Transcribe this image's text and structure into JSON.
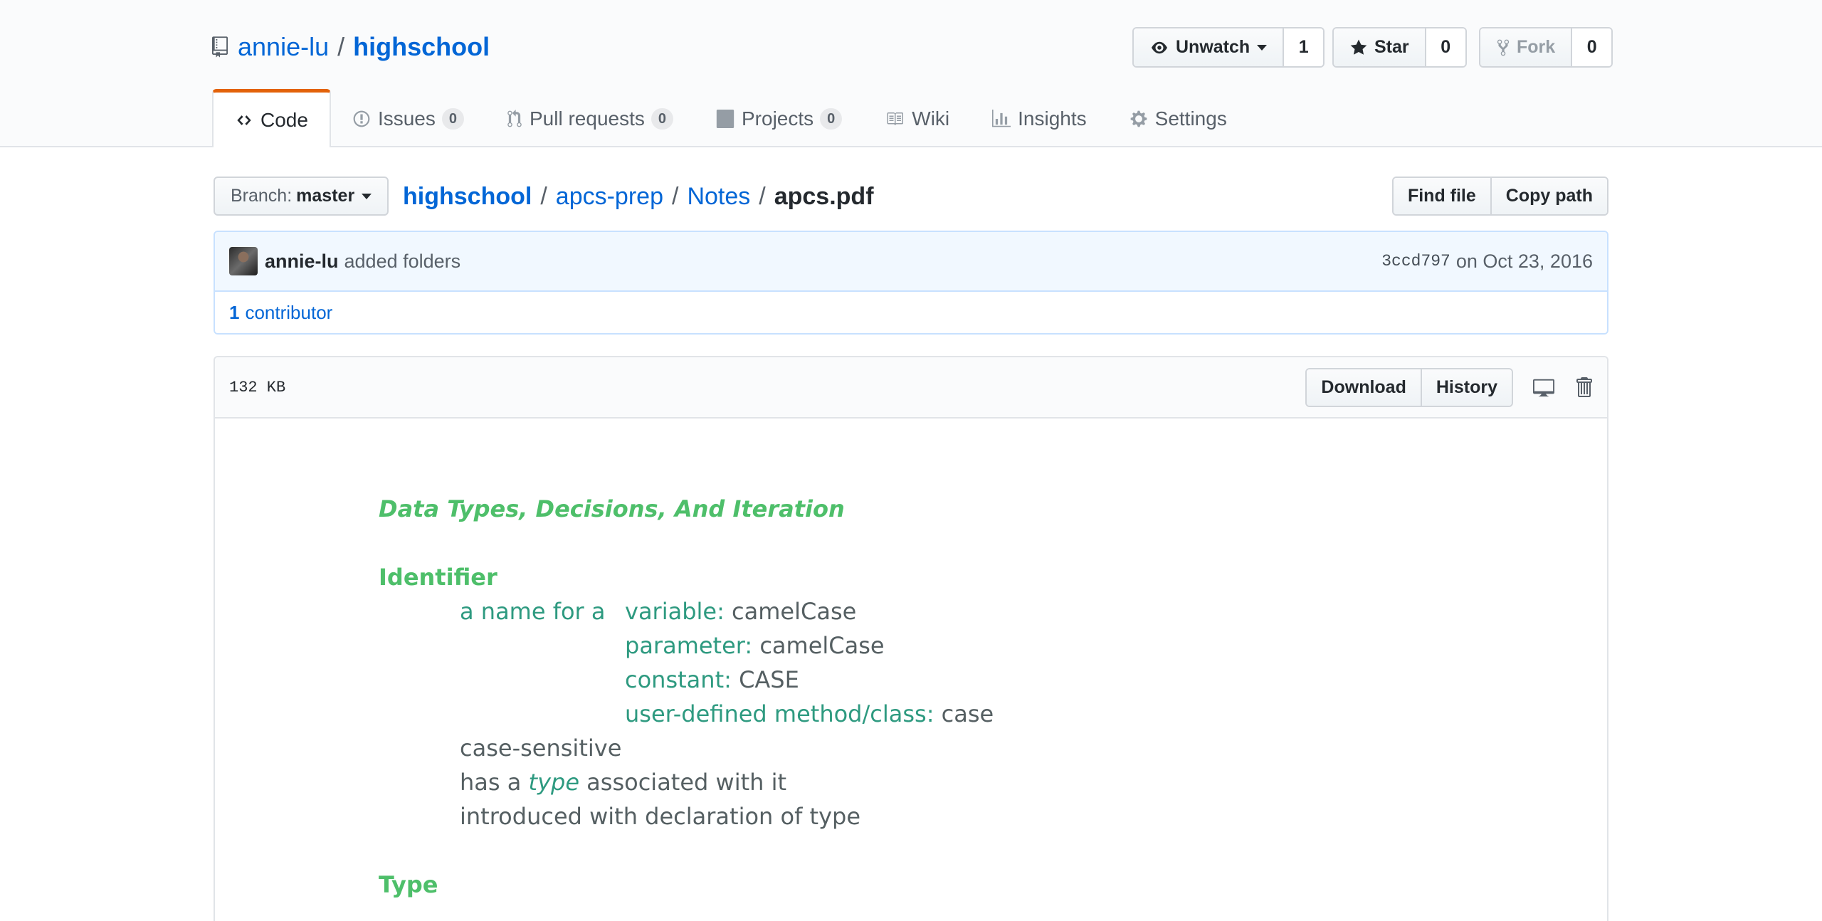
{
  "repo": {
    "owner": "annie-lu",
    "separator": "/",
    "name": "highschool"
  },
  "actions": {
    "watch": {
      "label": "Unwatch",
      "count": "1"
    },
    "star": {
      "label": "Star",
      "count": "0"
    },
    "fork": {
      "label": "Fork",
      "count": "0"
    }
  },
  "tabs": [
    {
      "label": "Code",
      "icon": "code-icon",
      "selected": true
    },
    {
      "label": "Issues",
      "count": "0",
      "icon": "issue-icon"
    },
    {
      "label": "Pull requests",
      "count": "0",
      "icon": "pull-request-icon"
    },
    {
      "label": "Projects",
      "count": "0",
      "icon": "project-icon"
    },
    {
      "label": "Wiki",
      "icon": "book-icon"
    },
    {
      "label": "Insights",
      "icon": "graph-icon"
    },
    {
      "label": "Settings",
      "icon": "gear-icon"
    }
  ],
  "branch": {
    "prefix": "Branch:",
    "name": "master"
  },
  "breadcrumb": {
    "root": "highschool",
    "sep": "/",
    "parts": [
      "apcs-prep",
      "Notes"
    ],
    "file": "apcs.pdf"
  },
  "file_nav_buttons": {
    "find_file": "Find file",
    "copy_path": "Copy path"
  },
  "commit": {
    "author": "annie-lu",
    "message": "added folders",
    "sha": "3ccd797",
    "date": "on Oct 23, 2016"
  },
  "contributors": {
    "count": "1",
    "label": "contributor"
  },
  "file": {
    "size": "132 KB",
    "download": "Download",
    "history": "History"
  },
  "colors": {
    "link": "#0366d6",
    "tab_accent": "#e36209",
    "pdf_heading_green": "#4ebf6a",
    "pdf_term_teal": "#2e9a80",
    "pdf_body_gray": "#555f62"
  },
  "pdf": {
    "title": "Data Types, Decisions, And Iteration",
    "identifier_heading": "Identifier",
    "name_for": "a name for a",
    "items": [
      {
        "term": "variable:",
        "value": "camelCase"
      },
      {
        "term": "parameter:",
        "value": "camelCase"
      },
      {
        "term": "constant:",
        "value": "CASE"
      },
      {
        "term": "user-defined method/class:",
        "value": "case"
      }
    ],
    "case_sensitive": "case-sensitive",
    "has_a": "has a",
    "type_word": "type",
    "associated": "associated with it",
    "introduced": "introduced with declaration of type",
    "type_heading": "Type"
  }
}
